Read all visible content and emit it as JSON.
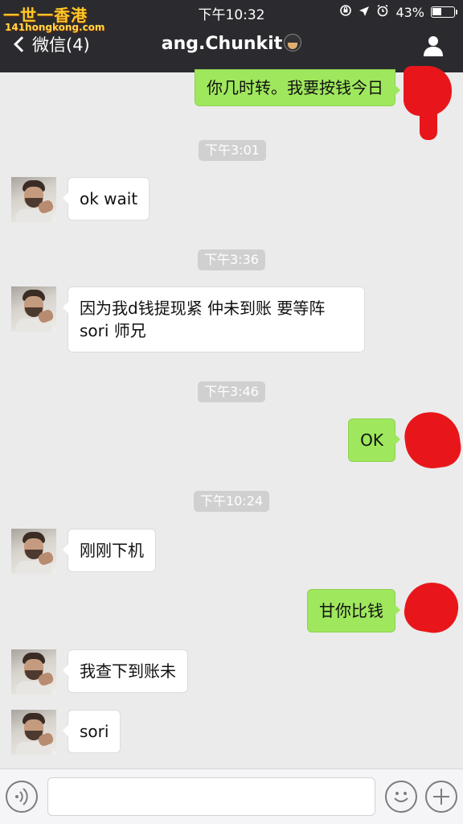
{
  "status_bar": {
    "watermark_cn": "一世一香港",
    "watermark_url": "141hongkong.com",
    "time": "下午10:32",
    "battery": "43%",
    "battery_level": 0.43
  },
  "nav": {
    "back_label": "微信(4)",
    "title": "ang.Chunkit",
    "title_emoji": "avatar-emoji"
  },
  "messages": [
    {
      "type": "out",
      "text": "你几时转。我要按钱今日"
    },
    {
      "type": "time",
      "text": "下午3:01"
    },
    {
      "type": "in",
      "text": "ok wait"
    },
    {
      "type": "time",
      "text": "下午3:36"
    },
    {
      "type": "in",
      "lines": [
        "因为我d钱提现紧 仲未到账 要等阵",
        "sori 师兄"
      ]
    },
    {
      "type": "time",
      "text": "下午3:46"
    },
    {
      "type": "out",
      "text": "OK"
    },
    {
      "type": "time",
      "text": "下午10:24"
    },
    {
      "type": "in",
      "text": "刚刚下机"
    },
    {
      "type": "out",
      "text": "甘你比钱"
    },
    {
      "type": "in",
      "text": "我查下到账未"
    },
    {
      "type": "in",
      "text": "sori"
    }
  ],
  "input_bar": {
    "placeholder": "",
    "voice_icon": "voice-icon",
    "emoji_icon": "emoji-icon",
    "plus_icon": "plus-icon"
  },
  "colors": {
    "nav_bg": "#2b2b2f",
    "chat_bg": "#ebebeb",
    "outgoing_bubble": "#9fe75d",
    "incoming_bubble": "#ffffff",
    "timestamp_bg": "#d0d0d0",
    "redaction": "#e8161a"
  }
}
